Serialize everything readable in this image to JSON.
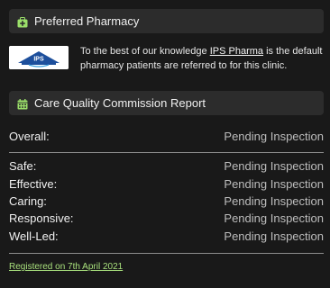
{
  "pharmacy": {
    "header": {
      "title": "Preferred Pharmacy",
      "icon": "pharmacy-bag-icon"
    },
    "logo": {
      "text": "IPS",
      "icon": "ips-pharma-logo"
    },
    "text_before": "To the best of our knowledge ",
    "link": "IPS Pharma",
    "text_after": " is the default pharmacy patients are referred to for this clinic."
  },
  "cqc": {
    "header": {
      "title": "Care Quality Commission Report",
      "icon": "calendar-icon"
    },
    "overall": {
      "label": "Overall:",
      "value": "Pending Inspection"
    },
    "ratings": [
      {
        "label": "Safe:",
        "value": "Pending Inspection"
      },
      {
        "label": "Effective:",
        "value": "Pending Inspection"
      },
      {
        "label": "Caring:",
        "value": "Pending Inspection"
      },
      {
        "label": "Responsive:",
        "value": "Pending Inspection"
      },
      {
        "label": "Well-Led:",
        "value": "Pending Inspection"
      }
    ],
    "registered": "Registered on 7th April 2021"
  },
  "colors": {
    "background": "#191919",
    "header_bg": "#2c2c2c",
    "icon_green": "#9be06a",
    "link_green": "#a8e07c",
    "logo_blue": "#1d4f9c"
  }
}
